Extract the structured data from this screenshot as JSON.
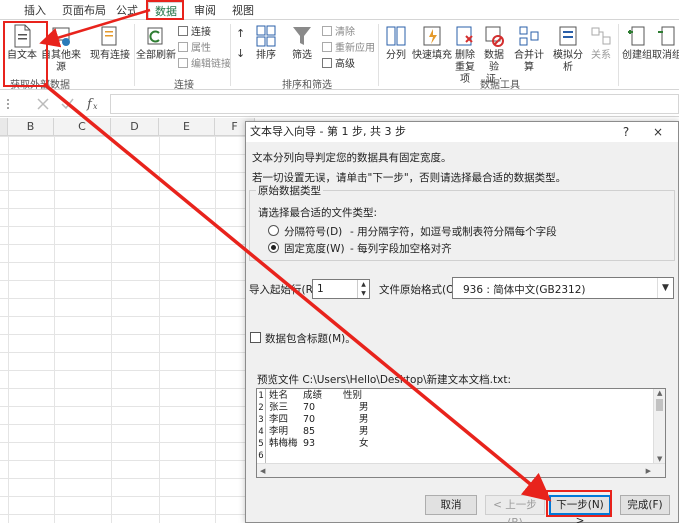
{
  "ribbon_tabs": [
    "插入",
    "页面布局",
    "公式",
    "数据",
    "审阅",
    "视图"
  ],
  "active_tab": "数据",
  "ribbon": {
    "from_text": "自文本",
    "from_other": "自其他来源",
    "existing_connections": "现有连接",
    "refresh_all": "全部刷新",
    "connections": "连接",
    "properties": "属性",
    "edit_links": "编辑链接",
    "sort_asc": "↑",
    "sort_desc": "↓",
    "sort": "排序",
    "filter": "筛选",
    "clear": "清除",
    "reapply": "重新应用",
    "advanced": "高级",
    "text_to_columns": "分列",
    "flash_fill": "快速填充",
    "remove_duplicates_1": "删除",
    "remove_duplicates_2": "重复项",
    "data_validation_1": "数据验",
    "data_validation_2": "证 ·",
    "consolidate": "合并计算",
    "what_if": "模拟分析",
    "relationships": "关系",
    "group": "创建组",
    "ungroup": "取消组",
    "groups": {
      "get_external": "获取外部数据",
      "connections": "连接",
      "sort_filter": "排序和筛选",
      "data_tools": "数据工具"
    }
  },
  "sheet": {
    "columns": [
      "B",
      "C",
      "D",
      "E",
      "F"
    ]
  },
  "dialog": {
    "title": "文本导入向导 - 第 1 步, 共 3 步",
    "help": "?",
    "close": "×",
    "intro": "文本分列向导判定您的数据具有固定宽度。",
    "instruction": "若一切设置无误，请单击\"下一步\"，否则请选择最合适的数据类型。",
    "group_title": "原始数据类型",
    "choose_label": "请选择最合适的文件类型:",
    "option_delimited": "分隔符号(D)",
    "option_delimited_desc": "- 用分隔字符，如逗号或制表符分隔每个字段",
    "option_fixed": "固定宽度(W)",
    "option_fixed_desc": "- 每列字段加空格对齐",
    "start_row_label": "导入起始行(R):",
    "start_row_value": "1",
    "origin_label": "文件原始格式(O):",
    "origin_value": "936 : 简体中文(GB2312)",
    "header_checkbox": "数据包含标题(M)。",
    "preview_label": "预览文件 C:\\Users\\Hello\\Desktop\\新建文本文档.txt:",
    "preview_rows": [
      {
        "n": "1",
        "name": "姓名",
        "score": "成绩",
        "gender": "性别"
      },
      {
        "n": "2",
        "name": "张三",
        "score": "70",
        "gender": "男"
      },
      {
        "n": "3",
        "name": "李四",
        "score": "70",
        "gender": "男"
      },
      {
        "n": "4",
        "name": "李明",
        "score": "85",
        "gender": "男"
      },
      {
        "n": "5",
        "name": "韩梅梅",
        "score": "93",
        "gender": "女"
      },
      {
        "n": "6",
        "name": "",
        "score": "",
        "gender": ""
      }
    ],
    "btn_cancel": "取消",
    "btn_prev": "< 上一步(B)",
    "btn_next": "下一步(N) >",
    "btn_finish": "完成(F)"
  },
  "colors": {
    "accent": "#217346",
    "annotation": "#e8231c",
    "focus": "#0078d7"
  }
}
